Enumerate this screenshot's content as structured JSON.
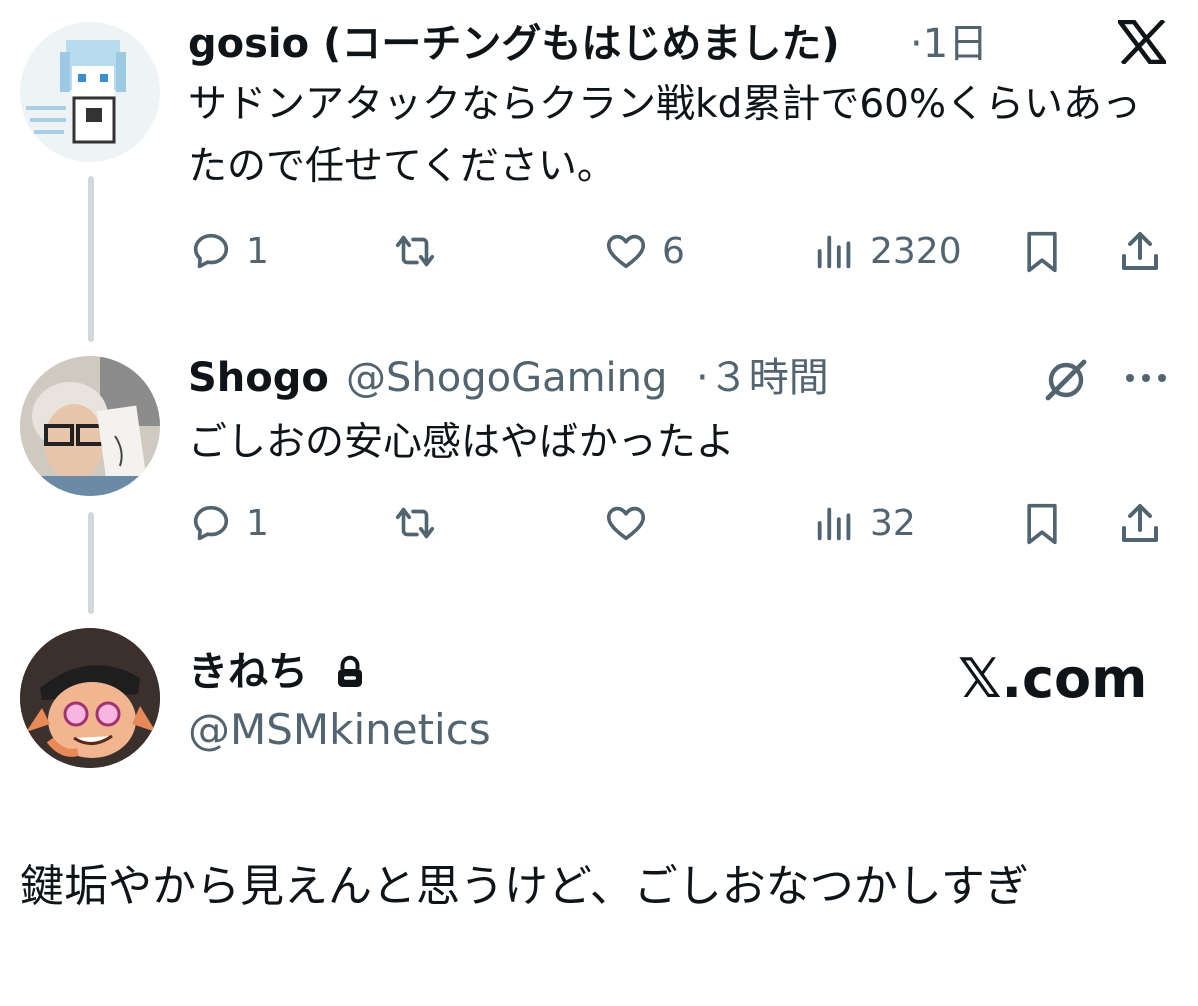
{
  "tweets": [
    {
      "display_name": "gosio (コーチングもはじめました)",
      "time": "·1日",
      "text": "サドンアタックならクラン戦kd累計で60%くらいあったので任せてください。",
      "replies": "1",
      "likes": "6",
      "views": "2320",
      "avatar_icon": "pixel-art-avatar"
    },
    {
      "display_name": "Shogo",
      "handle": "@ShogoGaming",
      "time": "·３時間",
      "text": "ごしおの安心感はやばかったよ",
      "replies": "1",
      "likes": "",
      "views": "32",
      "avatar_icon": "photo-avatar"
    }
  ],
  "quoted_card": {
    "display_name": "きねち",
    "handle": "@MSMkinetics",
    "brand": "𝕏.com",
    "text": "鍵垢やから見えんと思うけど、ごしおなつかしすぎ"
  },
  "colors": {
    "text": "#0f1419",
    "secondary": "#536471",
    "thread_line": "#cfd9de"
  }
}
